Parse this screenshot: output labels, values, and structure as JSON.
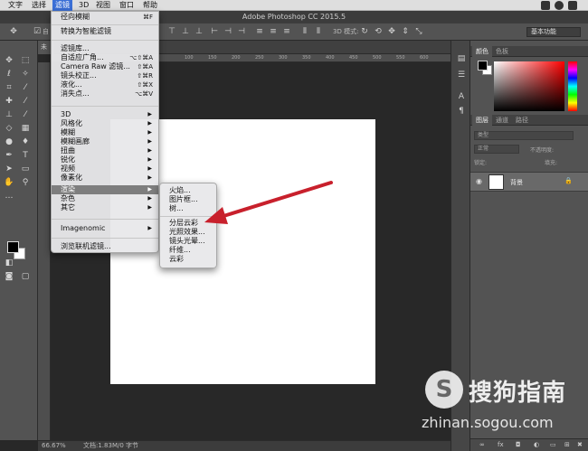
{
  "menubar": {
    "items": [
      "文字",
      "选择",
      "滤镜",
      "3D",
      "视图",
      "窗口",
      "帮助"
    ],
    "active": "滤镜"
  },
  "window": {
    "title": "Adobe Photoshop CC 2015.5"
  },
  "options_bar": {
    "auto_label": "自",
    "mode_3d": "3D 模式:",
    "workspace": "基本功能"
  },
  "document": {
    "tab": "未"
  },
  "rulers": {
    "h_ticks": [
      "0",
      "100",
      "150",
      "200",
      "250",
      "300",
      "350",
      "400",
      "450",
      "500",
      "550",
      "600",
      "650",
      "700",
      "750",
      "800"
    ]
  },
  "filter_menu": {
    "items": [
      {
        "label": "径向模糊",
        "shortcut": "⌘F"
      },
      {
        "label": "转换为智能滤镜"
      },
      {
        "label": "滤镜库..."
      },
      {
        "label": "自适应广角...",
        "shortcut": "⌥⇧⌘A"
      },
      {
        "label": "Camera Raw 滤镜...",
        "shortcut": "⇧⌘A"
      },
      {
        "label": "镜头校正...",
        "shortcut": "⇧⌘R"
      },
      {
        "label": "液化...",
        "shortcut": "⇧⌘X"
      },
      {
        "label": "消失点...",
        "shortcut": "⌥⌘V"
      },
      {
        "label": "3D"
      },
      {
        "label": "风格化"
      },
      {
        "label": "模糊"
      },
      {
        "label": "模糊画廊"
      },
      {
        "label": "扭曲"
      },
      {
        "label": "锐化"
      },
      {
        "label": "视频"
      },
      {
        "label": "像素化"
      },
      {
        "label": "渲染"
      },
      {
        "label": "杂色"
      },
      {
        "label": "其它"
      },
      {
        "label": "Imagenomic"
      },
      {
        "label": "浏览联机滤镜..."
      }
    ],
    "submenu_arrow": "▶"
  },
  "render_submenu": {
    "items": [
      "火焰...",
      "图片框...",
      "树...",
      "分层云彩",
      "光照效果...",
      "镜头光晕...",
      "纤维...",
      "云彩"
    ]
  },
  "panels": {
    "color_tabs": [
      "颜色",
      "色板"
    ],
    "layer_tabs": [
      "图层",
      "通道",
      "路径"
    ],
    "kind_label": "类型",
    "blend_mode": "正常",
    "opacity": "不透明度:",
    "fill": "填充:",
    "lock": "锁定:",
    "layer_name": "背景",
    "bottom_icons": [
      "∞",
      "fx"
    ]
  },
  "status": {
    "zoom": "66.67%",
    "doc_info": "文档:1.83M/0 字节"
  },
  "watermark": {
    "brand": "搜狗指南",
    "url": "zhinan.sogou.com"
  },
  "colors": {
    "menu_highlight": "#7e7e7e",
    "arrow": "#c8202c",
    "menubar_active": "#3b6fd6"
  }
}
